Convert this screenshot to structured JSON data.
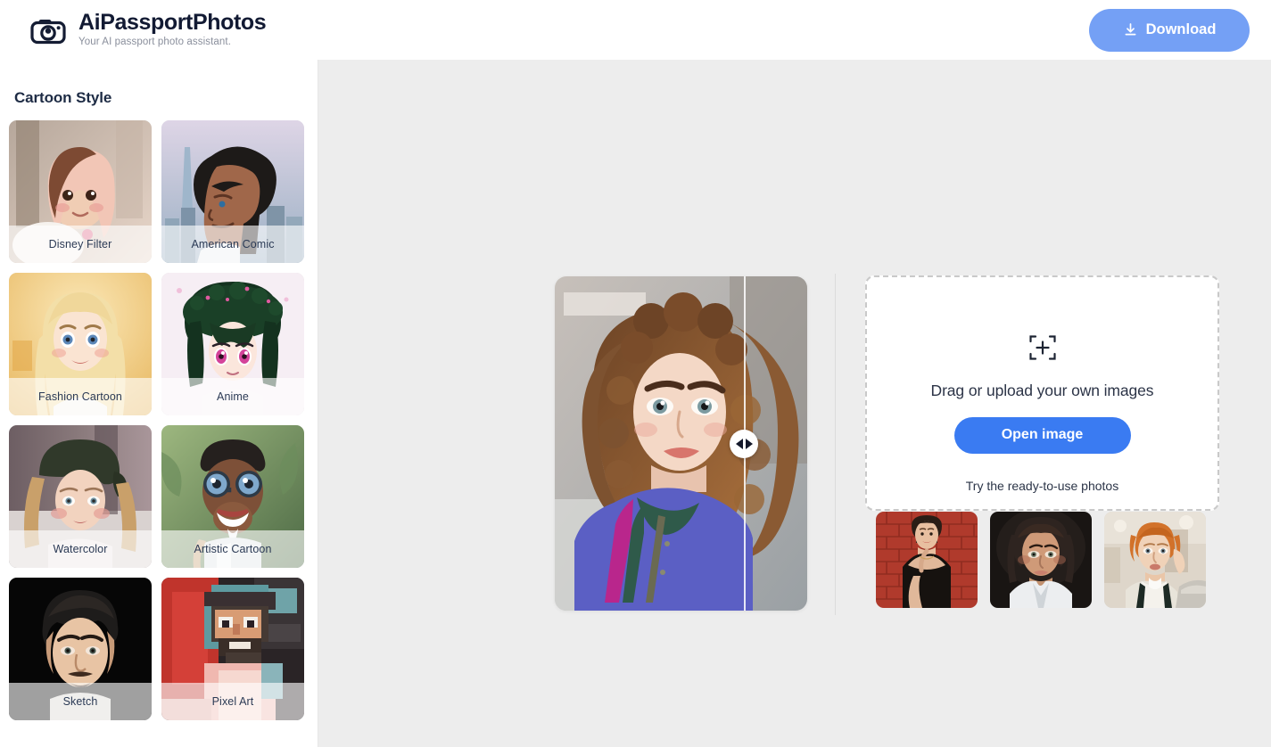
{
  "header": {
    "logo_icon": "camera-icon",
    "brand_title": "AiPassportPhotos",
    "brand_subtitle": "Your AI passport photo assistant.",
    "download_label": "Download",
    "download_icon": "download-icon",
    "download_color": "#74a0f5"
  },
  "sidebar": {
    "title": "Cartoon Style",
    "styles": [
      {
        "label": "Disney Filter"
      },
      {
        "label": "American Comic"
      },
      {
        "label": "Fashion Cartoon"
      },
      {
        "label": "Anime"
      },
      {
        "label": "Watercolor"
      },
      {
        "label": "Artistic Cartoon"
      },
      {
        "label": "Sketch"
      },
      {
        "label": "Pixel Art"
      }
    ]
  },
  "main": {
    "preview": {
      "name": "before-after-comparison",
      "split_percent": 75,
      "handle_icon": "left-right-arrows-icon"
    },
    "dropzone": {
      "icon": "add-image-icon",
      "text": "Drag or upload your own images",
      "button_label": "Open image",
      "button_color": "#3a7bf2"
    },
    "ready": {
      "title": "Try the ready-to-use photos",
      "thumbs": [
        {
          "name": "ready-photo-1"
        },
        {
          "name": "ready-photo-2"
        },
        {
          "name": "ready-photo-3"
        }
      ]
    }
  }
}
